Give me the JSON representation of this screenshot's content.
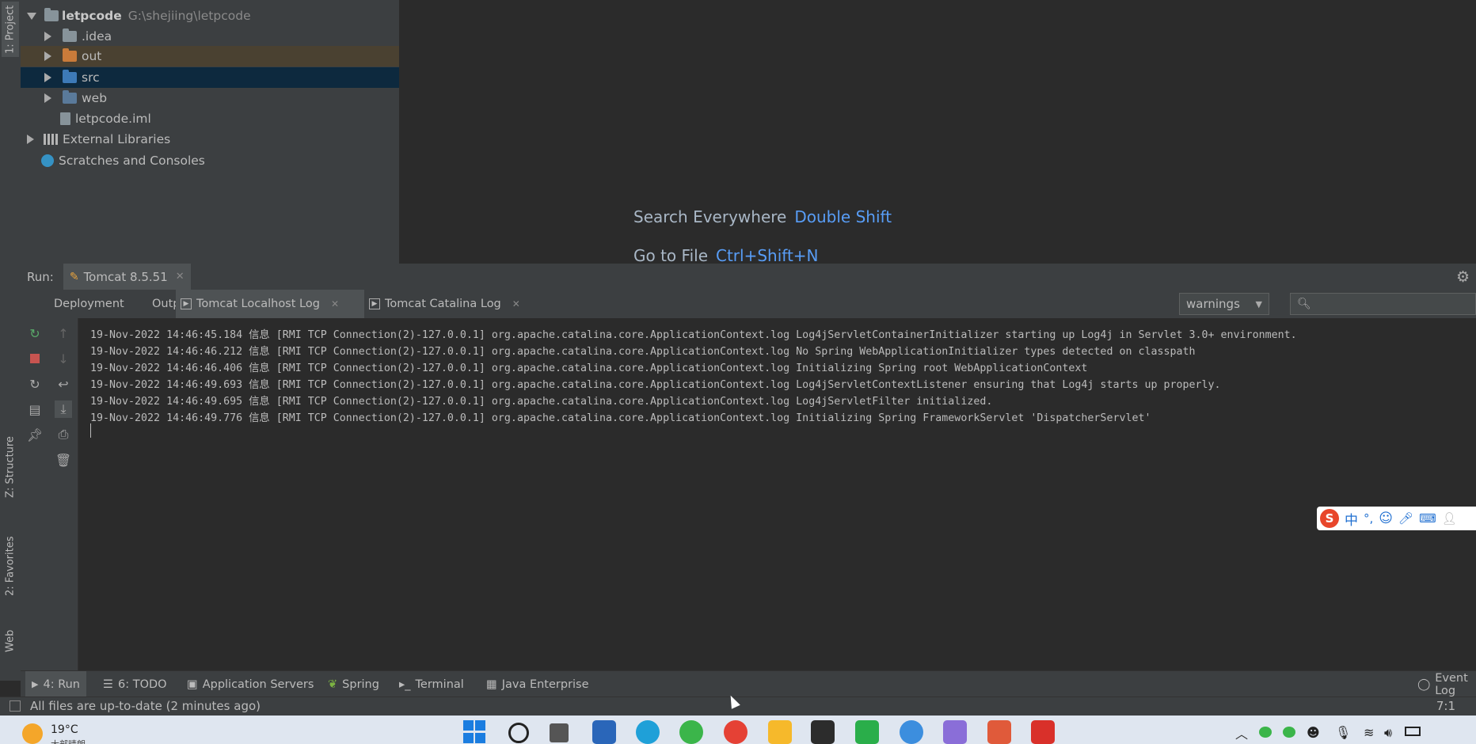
{
  "left_strip": {
    "project_tab": "1: Project",
    "structure_tab": "Z: Structure",
    "favorites_tab": "2: Favorites",
    "web_tab": "Web"
  },
  "project": {
    "root_name": "letpcode",
    "root_path": "G:\\shejiing\\letpcode",
    "items": [
      {
        "label": ".idea",
        "icon": "folder-icon",
        "color": "#87939a"
      },
      {
        "label": "out",
        "icon": "folder-icon",
        "color": "#c97b3a"
      },
      {
        "label": "src",
        "icon": "folder-icon",
        "color": "#3d7ab7"
      },
      {
        "label": "web",
        "icon": "web-folder-icon",
        "color": "#87939a"
      },
      {
        "label": "letpcode.iml",
        "icon": "file-icon",
        "color": "#87939a"
      }
    ],
    "external_libraries": "External Libraries",
    "scratches": "Scratches and Consoles"
  },
  "editor_hints": {
    "search_label": "Search Everywhere",
    "search_key": "Double Shift",
    "goto_label": "Go to File",
    "goto_key": "Ctrl+Shift+N"
  },
  "run": {
    "label": "Run:",
    "config_tab": "Tomcat 8.5.51",
    "tabs": [
      "Deployment",
      "Output",
      "Tomcat Localhost Log",
      "Tomcat Catalina Log"
    ],
    "filter_value": "warnings",
    "search_placeholder": ""
  },
  "console_lines": [
    "19-Nov-2022 14:46:45.184 信息 [RMI TCP Connection(2)-127.0.0.1] org.apache.catalina.core.ApplicationContext.log Log4jServletContainerInitializer starting up Log4j in Servlet 3.0+ environment.",
    "19-Nov-2022 14:46:46.212 信息 [RMI TCP Connection(2)-127.0.0.1] org.apache.catalina.core.ApplicationContext.log No Spring WebApplicationInitializer types detected on classpath",
    "19-Nov-2022 14:46:46.406 信息 [RMI TCP Connection(2)-127.0.0.1] org.apache.catalina.core.ApplicationContext.log Initializing Spring root WebApplicationContext",
    "19-Nov-2022 14:46:49.693 信息 [RMI TCP Connection(2)-127.0.0.1] org.apache.catalina.core.ApplicationContext.log Log4jServletContextListener ensuring that Log4j starts up properly.",
    "19-Nov-2022 14:46:49.695 信息 [RMI TCP Connection(2)-127.0.0.1] org.apache.catalina.core.ApplicationContext.log Log4jServletFilter initialized.",
    "19-Nov-2022 14:46:49.776 信息 [RMI TCP Connection(2)-127.0.0.1] org.apache.catalina.core.ApplicationContext.log Initializing Spring FrameworkServlet 'DispatcherServlet'"
  ],
  "bottom_tools": {
    "run": "4: Run",
    "todo": "6: TODO",
    "app_servers": "Application Servers",
    "spring": "Spring",
    "terminal": "Terminal",
    "java_ee": "Java Enterprise",
    "event_log": "Event Log"
  },
  "status": {
    "message": "All files are up-to-date (2 minutes ago)",
    "position": "7:1"
  },
  "taskbar": {
    "temperature": "19°C",
    "weather": "大部晴朗"
  },
  "ime": {
    "mode": "中"
  }
}
